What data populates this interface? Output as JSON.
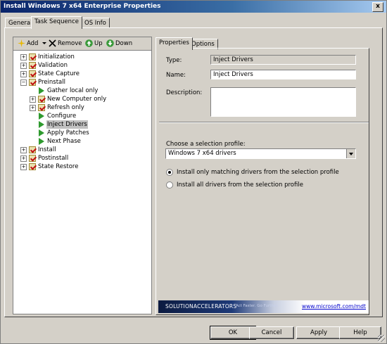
{
  "window": {
    "title": "Install Windows 7 x64 Enterprise Properties",
    "close_glyph": "x"
  },
  "main_tabs": [
    {
      "label": "General"
    },
    {
      "label": "Task Sequence"
    },
    {
      "label": "OS Info"
    }
  ],
  "toolbar": {
    "add": "Add",
    "remove": "Remove",
    "up": "Up",
    "down": "Down"
  },
  "tree": [
    {
      "label": "Initialization"
    },
    {
      "label": "Validation"
    },
    {
      "label": "State Capture"
    },
    {
      "label": "Preinstall"
    },
    {
      "label": "Gather local only"
    },
    {
      "label": "New Computer only"
    },
    {
      "label": "Refresh only"
    },
    {
      "label": "Configure"
    },
    {
      "label": "Inject Drivers"
    },
    {
      "label": "Apply Patches"
    },
    {
      "label": "Next Phase"
    },
    {
      "label": "Install"
    },
    {
      "label": "Postinstall"
    },
    {
      "label": "State Restore"
    }
  ],
  "right_tabs": [
    {
      "label": "Properties"
    },
    {
      "label": "Options"
    }
  ],
  "properties": {
    "type_label": "Type:",
    "type_value": "Inject Drivers",
    "name_label": "Name:",
    "name_value": "Inject Drivers",
    "description_label": "Description:",
    "description_value": "",
    "profile_label": "Choose a selection profile:",
    "profile_value": "Windows 7 x64 drivers",
    "radio_matching": "Install only matching drivers from the selection profile",
    "radio_all": "Install all drivers from the selection profile"
  },
  "banner": {
    "brand": "SOLUTIONACCELERATORS",
    "tagline": "Act Faster. Go Further.",
    "link": "www.microsoft.com/mdt"
  },
  "buttons": {
    "ok": "OK",
    "cancel": "Cancel",
    "apply": "Apply",
    "help": "Help"
  },
  "colors": {
    "title_bar": "#0a246a",
    "dialog_bg": "#d4d0c8",
    "check_red": "#c01010",
    "play_green": "#2e9a2e"
  }
}
